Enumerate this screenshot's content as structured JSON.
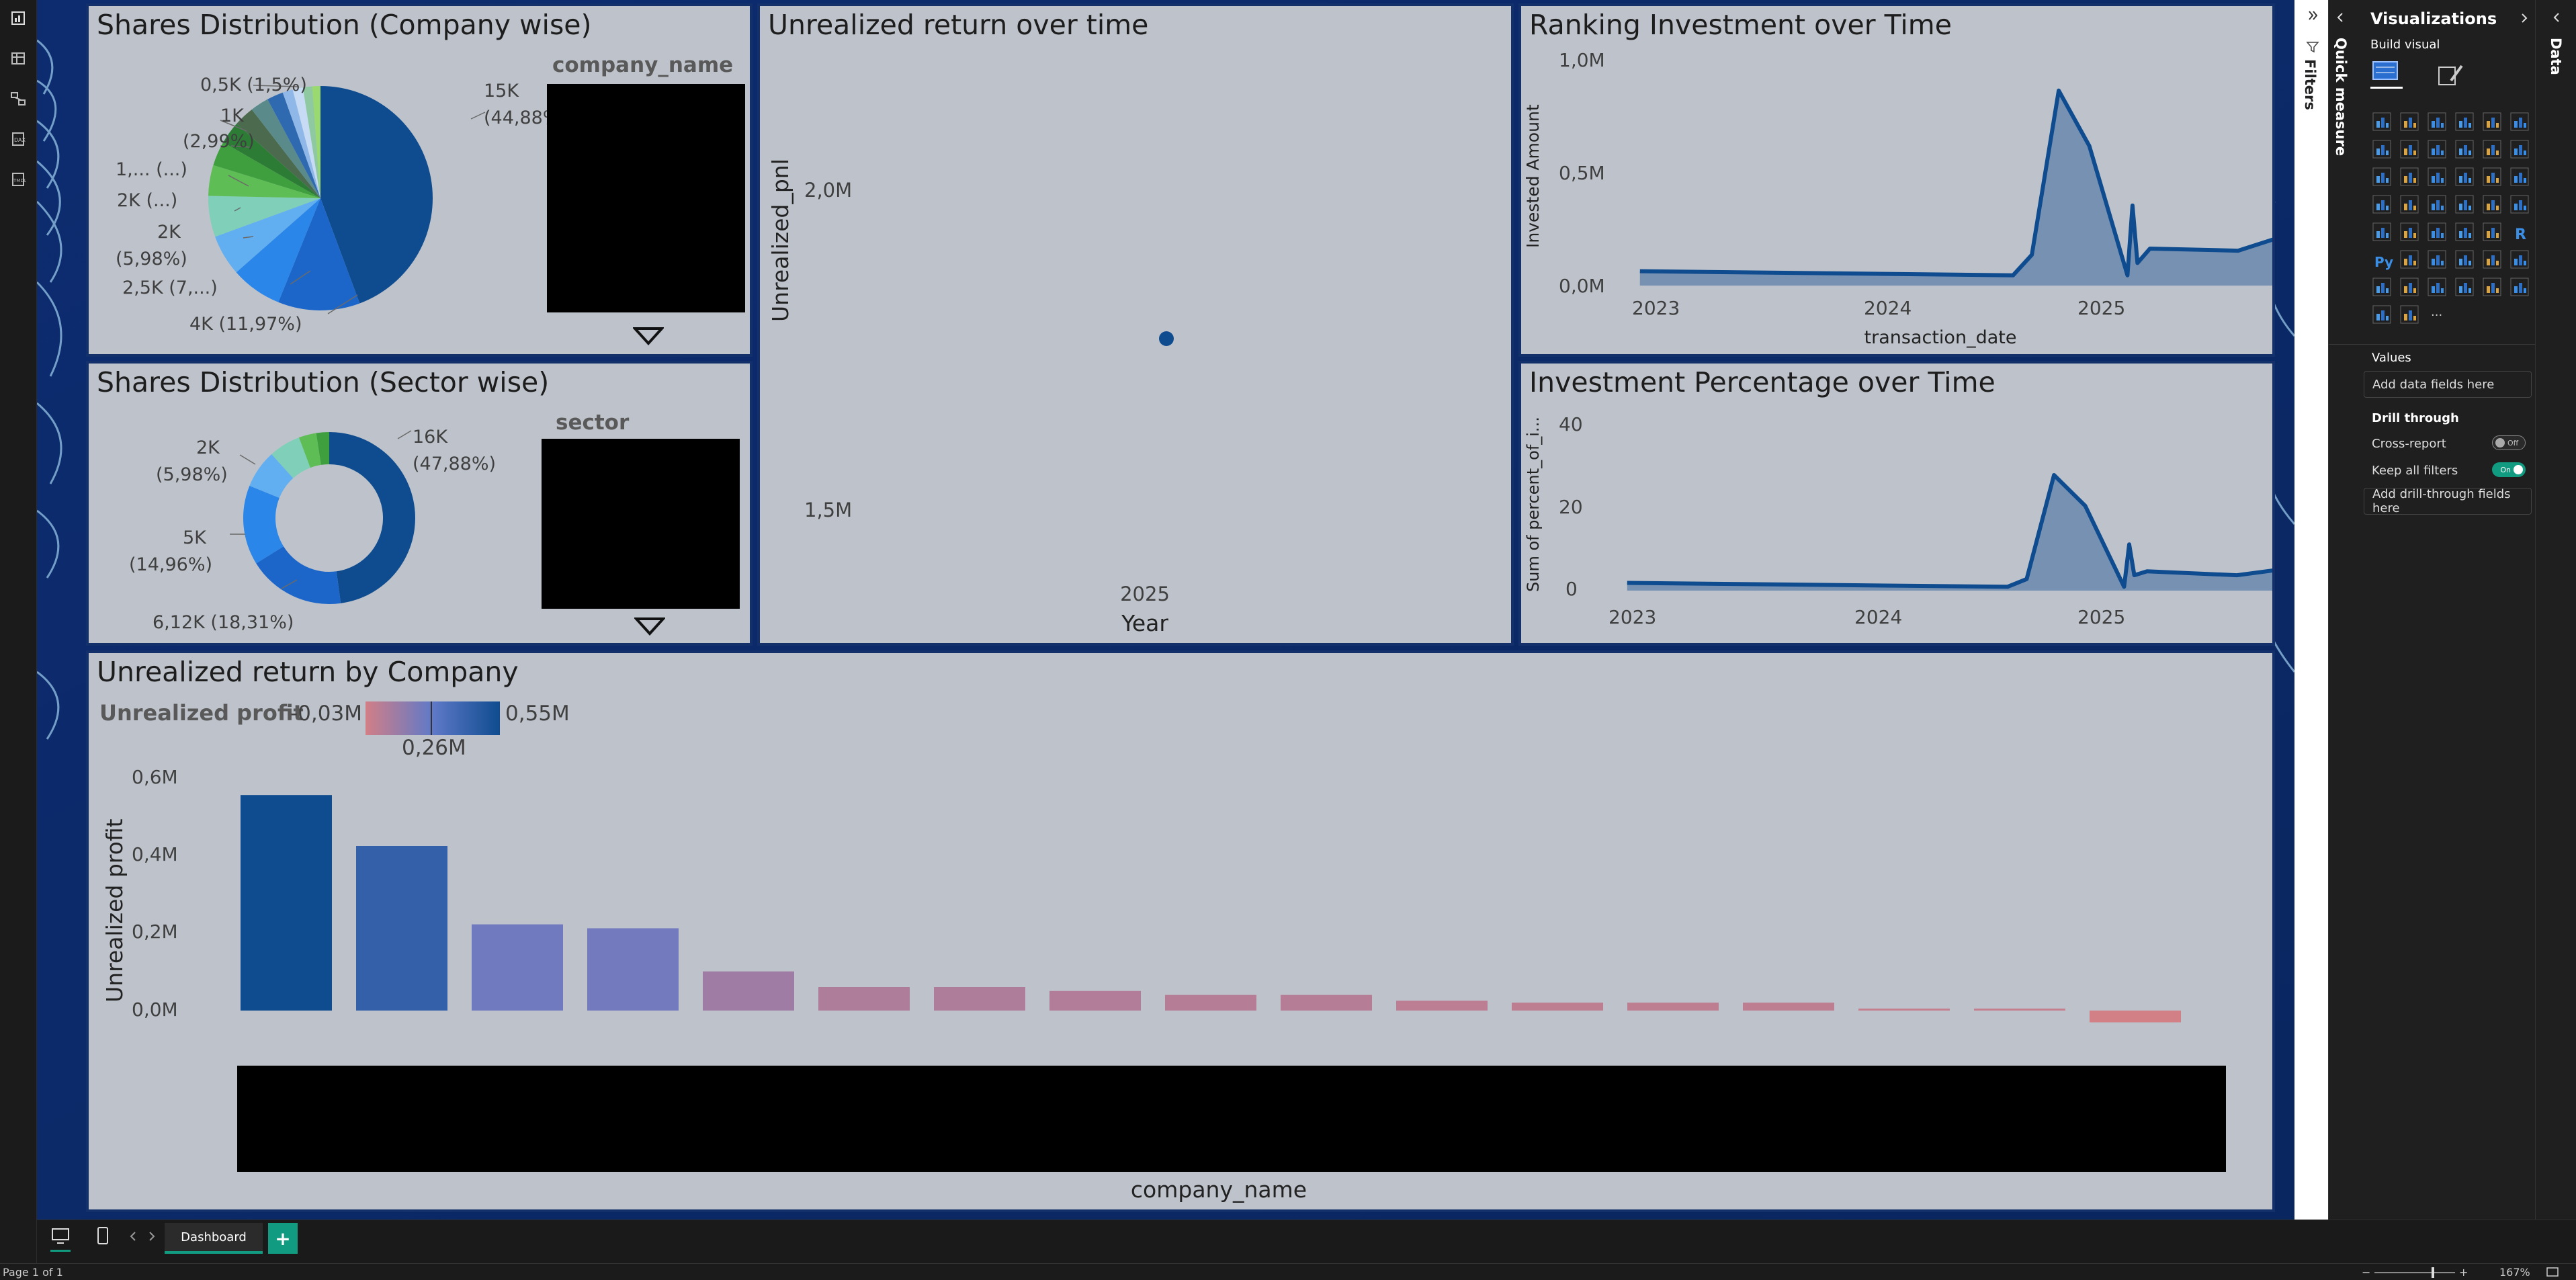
{
  "rail_icons": [
    "report-view-icon",
    "table-view-icon",
    "model-view-icon",
    "dax-query-icon",
    "tmdl-view-icon"
  ],
  "panels": {
    "company_pie": {
      "title": "Shares Distribution (Company wise)",
      "slicer_title": "company_name",
      "labels": [
        "0,5K (1,5%)",
        "1K",
        "(2,99%)",
        "1,... (...)",
        "2K (...)",
        "2K",
        "(5,98%)",
        "2,5K (7,...)",
        "4K (11,97%)",
        "15K",
        "(44,88%)"
      ]
    },
    "sector_donut": {
      "title": "Shares Distribution (Sector wise)",
      "slicer_title": "sector",
      "labels": [
        "2K",
        "(5,98%)",
        "5K",
        "(14,96%)",
        "6,12K (18,31%)",
        "16K",
        "(47,88%)"
      ]
    },
    "unrealized_time": {
      "title": "Unrealized return over time",
      "ylabel": "Unrealized_pnl",
      "xlabel": "Year",
      "y_ticks": [
        "2,0M",
        "1,5M"
      ],
      "x_ticks": [
        "2025"
      ]
    },
    "ranking": {
      "title": "Ranking Investment over Time",
      "ylabel": "Invested Amount",
      "xlabel": "transaction_date",
      "y_ticks": [
        "1,0M",
        "0,5M",
        "0,0M"
      ],
      "x_ticks": [
        "2023",
        "2024",
        "2025"
      ]
    },
    "percent": {
      "title": "Investment Percentage over Time",
      "ylabel": "Sum of percent_of_i...",
      "y_ticks": [
        "40",
        "20",
        "0"
      ],
      "x_ticks": [
        "2023",
        "2024",
        "2025"
      ]
    },
    "by_company": {
      "title": "Unrealized return by Company",
      "legend_label": "Unrealized profit",
      "legend_min": "-0,03M",
      "legend_mid": "0,26M",
      "legend_max": "0,55M",
      "ylabel": "Unrealized profit",
      "xlabel": "company_name",
      "y_ticks": [
        "0,6M",
        "0,4M",
        "0,2M",
        "0,0M"
      ]
    }
  },
  "chart_data": [
    {
      "type": "pie",
      "title": "Shares Distribution (Company wise)",
      "slices": [
        {
          "label": "15K (44,88%)",
          "value": 15000,
          "percent": 44.88,
          "color": "#0f4c8f"
        },
        {
          "label": "4K (11,97%)",
          "value": 4000,
          "percent": 11.97,
          "color": "#1c66c9"
        },
        {
          "label": "2,5K (7,...)",
          "value": 2500,
          "percent": 7.48,
          "color": "#2a86e8"
        },
        {
          "label": "2K (5,98%)",
          "value": 2000,
          "percent": 5.98,
          "color": "#61aef1"
        },
        {
          "label": "2K (...)",
          "value": 2000,
          "percent": 5.98,
          "color": "#7fcfb9"
        },
        {
          "label": "1,... (...)",
          "value": 1500,
          "percent": 4.49,
          "color": "#5fbd55"
        },
        {
          "label": "",
          "value": 1200,
          "percent": 3.59,
          "color": "#3f9f3e"
        },
        {
          "label": "",
          "value": 1100,
          "percent": 3.29,
          "color": "#2c7c36"
        },
        {
          "label": "1K (2,99%)",
          "value": 1000,
          "percent": 2.99,
          "color": "#4c6b4e"
        },
        {
          "label": "",
          "value": 900,
          "percent": 2.69,
          "color": "#5a8b8a"
        },
        {
          "label": "",
          "value": 800,
          "percent": 2.39,
          "color": "#2f6ab1"
        },
        {
          "label": "0,5K (1,5%)",
          "value": 500,
          "percent": 1.5,
          "color": "#8fb8e8"
        },
        {
          "label": "",
          "value": 500,
          "percent": 1.5,
          "color": "#c7dcf4"
        },
        {
          "label": "",
          "value": 450,
          "percent": 1.35,
          "color": "#8ec9a2"
        },
        {
          "label": "",
          "value": 400,
          "percent": 1.2,
          "color": "#99d96f"
        }
      ]
    },
    {
      "type": "pie",
      "title": "Shares Distribution (Sector wise)",
      "donut": true,
      "slices": [
        {
          "label": "16K (47,88%)",
          "value": 16000,
          "percent": 47.88,
          "color": "#0f4c8f"
        },
        {
          "label": "6,12K (18,31%)",
          "value": 6120,
          "percent": 18.31,
          "color": "#1c66c9"
        },
        {
          "label": "5K (14,96%)",
          "value": 5000,
          "percent": 14.96,
          "color": "#2a86e8"
        },
        {
          "label": "",
          "value": 2400,
          "percent": 7.18,
          "color": "#61aef1"
        },
        {
          "label": "2K (5,98%)",
          "value": 2000,
          "percent": 5.98,
          "color": "#7fcfb9"
        },
        {
          "label": "",
          "value": 1100,
          "percent": 3.29,
          "color": "#5fbd55"
        },
        {
          "label": "",
          "value": 810,
          "percent": 2.4,
          "color": "#3f9f3e"
        }
      ]
    },
    {
      "type": "scatter",
      "title": "Unrealized return over time",
      "xlabel": "Year",
      "ylabel": "Unrealized_pnl",
      "points": [
        {
          "x": 2025,
          "y": 1800000
        }
      ],
      "ylim": [
        1400000,
        2200000
      ]
    },
    {
      "type": "area",
      "title": "Ranking Investment over Time",
      "xlabel": "transaction_date",
      "ylabel": "Invested Amount",
      "ylim": [
        0,
        1100000
      ],
      "x": [
        "2022-11-01",
        "2024-06-20",
        "2024-07-20",
        "2024-09-01",
        "2024-10-20",
        "2024-12-20",
        "2024-12-28",
        "2025-01-05",
        "2025-01-25",
        "2025-06-15",
        "2025-09-15"
      ],
      "values": [
        70000,
        50000,
        150000,
        950000,
        680000,
        50000,
        390000,
        110000,
        180000,
        170000,
        260000
      ]
    },
    {
      "type": "area",
      "title": "Investment Percentage over Time",
      "ylabel": "Sum of percent_of_i...",
      "ylim": [
        0,
        45
      ],
      "x": [
        "2022-11-01",
        "2024-06-20",
        "2024-07-20",
        "2024-09-01",
        "2024-10-20",
        "2024-12-20",
        "2024-12-28",
        "2025-01-05",
        "2025-01-25",
        "2025-06-15",
        "2025-09-15"
      ],
      "values": [
        2,
        1,
        3,
        30,
        22,
        1,
        12,
        4,
        5,
        4,
        6
      ]
    },
    {
      "type": "bar",
      "title": "Unrealized return by Company",
      "xlabel": "company_name",
      "ylabel": "Unrealized profit",
      "ylim": [
        -0.03,
        0.6
      ],
      "values": [
        0.55,
        0.42,
        0.22,
        0.21,
        0.1,
        0.06,
        0.06,
        0.05,
        0.04,
        0.04,
        0.025,
        0.02,
        0.02,
        0.02,
        0.005,
        0.005,
        -0.03
      ]
    }
  ],
  "filters_label": "Filters",
  "quick_measure_label": "Quick measure",
  "viz": {
    "title": "Visualizations",
    "build_visual": "Build visual",
    "values_label": "Values",
    "add_fields": "Add data fields here",
    "drill_through": "Drill through",
    "cross_report": "Cross-report",
    "cross_report_state": "Off",
    "keep_filters": "Keep all filters",
    "keep_filters_state": "On",
    "add_drill": "Add drill-through fields here",
    "r_label": "R",
    "py_label": "Py",
    "more_label": "···"
  },
  "data_label": "Data",
  "tabs": {
    "page": "Dashboard",
    "add": "+"
  },
  "status": {
    "page": "Page 1 of 1",
    "zoom": "167%"
  },
  "colors": {
    "panel_bg": "#bec3cb",
    "canvas_bg": "#0b2a6b",
    "accent": "#119c82",
    "line_blue": "#0f4c8f",
    "bar_high": "#0f4c8f",
    "bar_mid": "#5f79c8",
    "bar_low": "#c7767a"
  }
}
